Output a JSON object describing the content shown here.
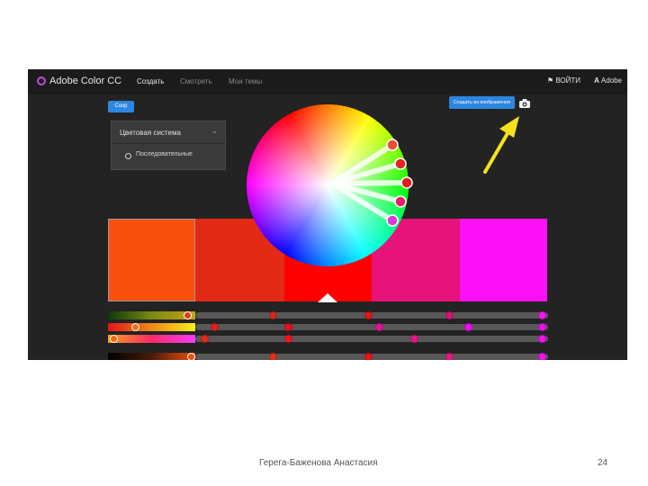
{
  "app": {
    "title": "Adobe Color CC"
  },
  "nav": {
    "create": "Создать",
    "explore": "Смотреть",
    "my_themes": "Мои темы"
  },
  "header_right": {
    "login": "ВОЙТИ",
    "brand": "Adobe"
  },
  "toolbar": {
    "save_label": "Сохр",
    "create_from_image": "Создать из изображения"
  },
  "color_rule_panel": {
    "title": "Цветовая система",
    "option": "Последовательные"
  },
  "palette": [
    {
      "color": "#f9500f"
    },
    {
      "color": "#e32a17"
    },
    {
      "color": "#fe0000"
    },
    {
      "color": "#e6137a"
    },
    {
      "color": "#fd10f7"
    }
  ],
  "wheel_markers": [
    {
      "color": "#ee4d3a"
    },
    {
      "color": "#e6231d"
    },
    {
      "color": "#e41b1b"
    },
    {
      "color": "#e91d6b"
    },
    {
      "color": "#db3ad8"
    }
  ],
  "slider_rows": [
    {
      "markers": [
        "#e23a18",
        "#d42a1c",
        "#e8141c",
        "#d8137a",
        "#f616f3"
      ]
    },
    {
      "markers": [
        "#f37012",
        "#e51f1b",
        "#ef0d1b",
        "#e5139a",
        "#f20ef0"
      ]
    },
    {
      "markers": [
        "#f5650f",
        "#e42d19",
        "#fe0e1a",
        "#e8158f",
        "#f812f5"
      ]
    },
    {
      "markers": [
        "#ee4d12",
        "#e1301b",
        "#f00f1b",
        "#e51a84",
        "#fa12f7"
      ]
    }
  ],
  "slide": {
    "footer": "Герега-Баженова Анастасия",
    "page_number": "24"
  }
}
